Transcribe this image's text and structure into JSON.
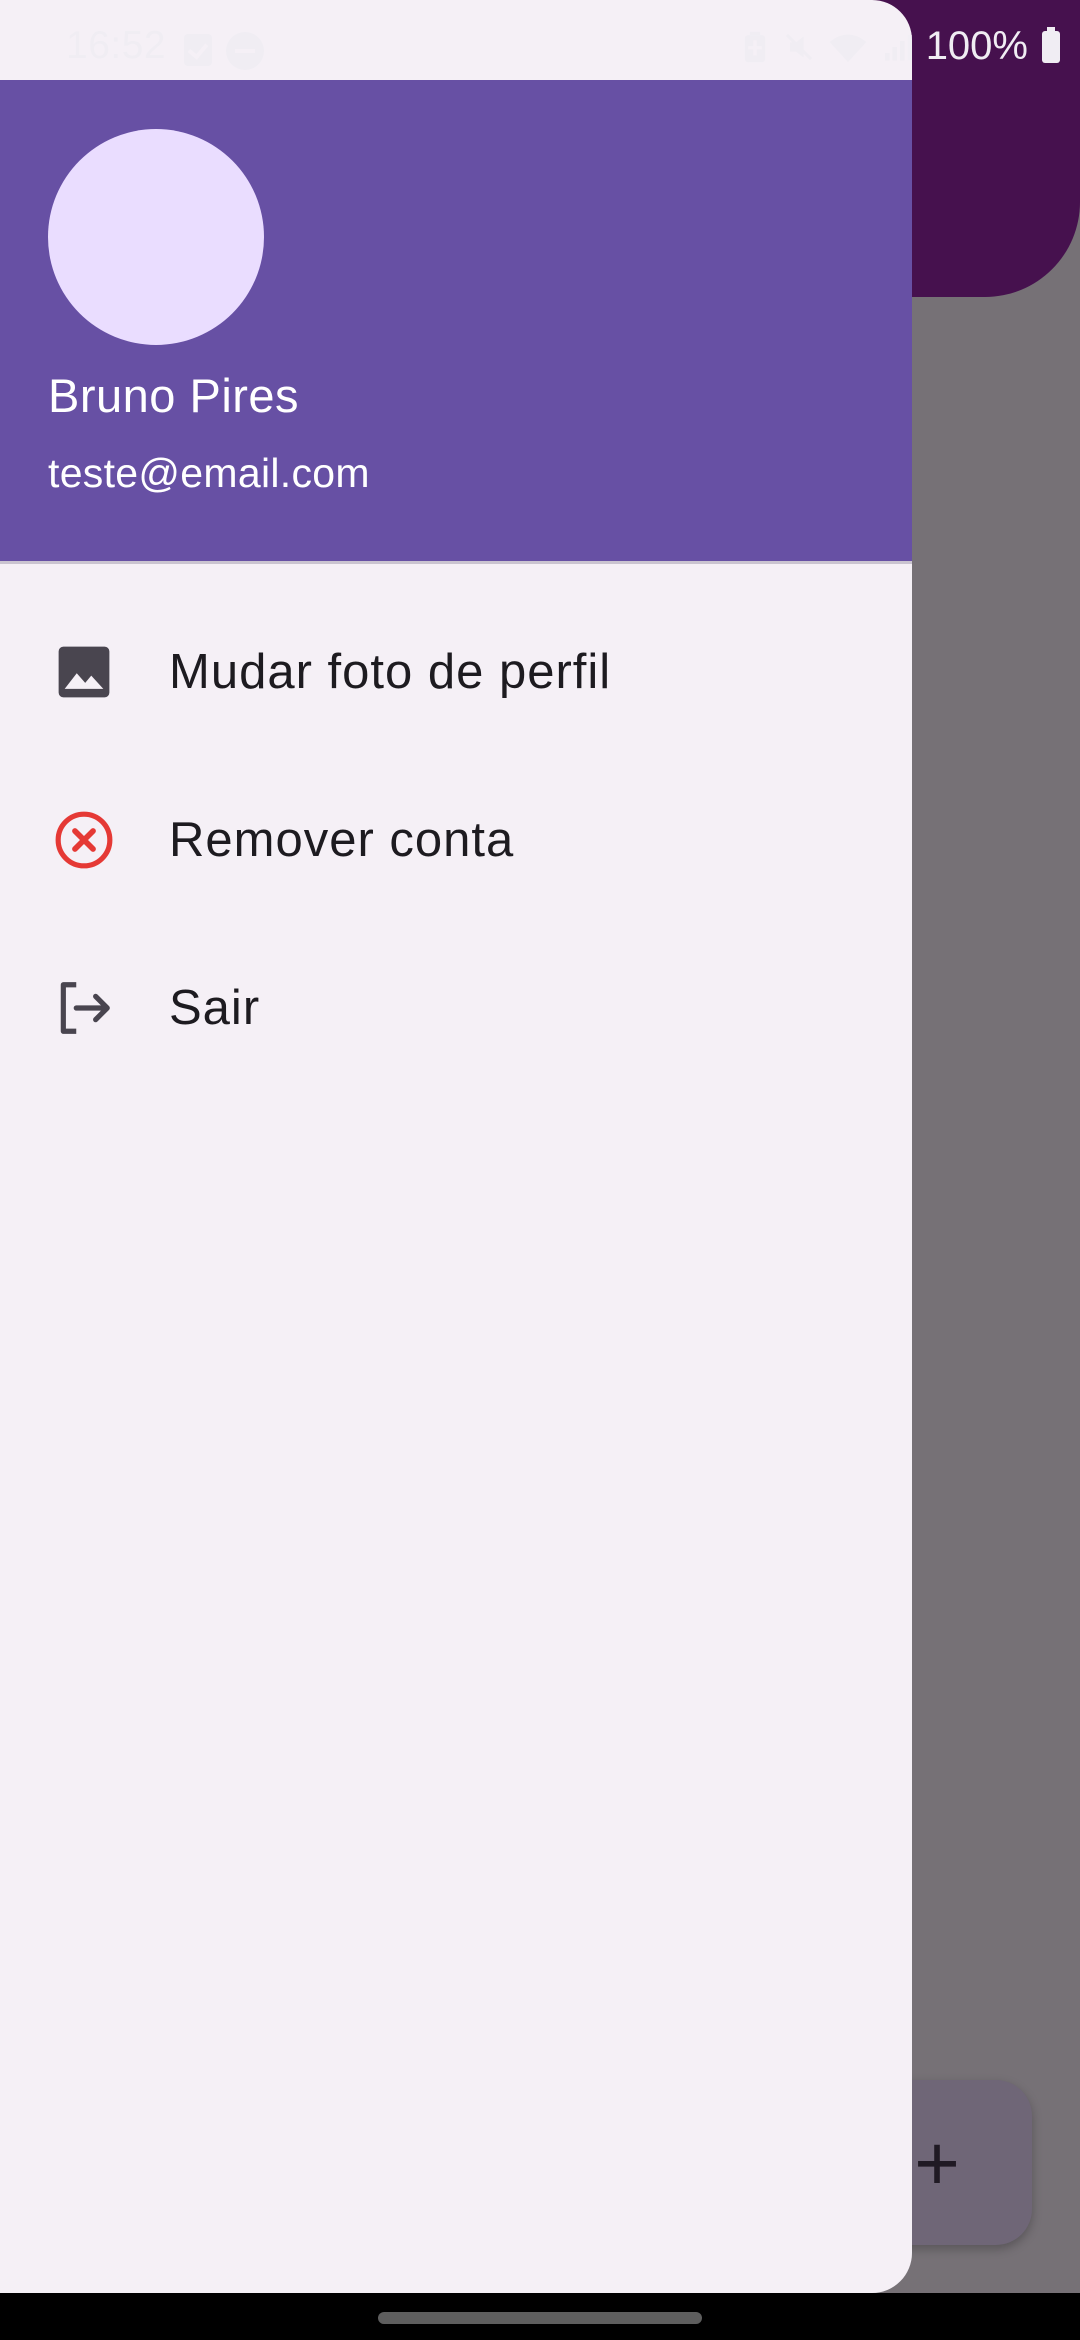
{
  "status_bar": {
    "time": "16:52",
    "battery": "100%"
  },
  "drawer": {
    "account_name": "Bruno Pires",
    "account_email": "teste@email.com",
    "items": [
      {
        "label": "Mudar foto de perfil",
        "icon": "image-icon"
      },
      {
        "label": "Remover conta",
        "icon": "cancel-icon",
        "icon_color": "#e53935"
      },
      {
        "label": "Sair",
        "icon": "logout-icon"
      }
    ]
  },
  "background": {
    "fab_label": "+"
  },
  "colors": {
    "header": "#6750a4",
    "avatar": "#eaddff",
    "drawer_bg": "#f5f0f6",
    "scrim": "#767176",
    "appbar_dimmed": "#46114e"
  }
}
